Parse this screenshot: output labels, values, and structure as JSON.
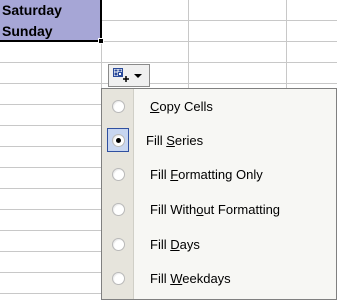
{
  "sheet": {
    "selected_cells": [
      "Saturday",
      "Sunday"
    ]
  },
  "autofill_button": {
    "icon": "autofill-options-icon",
    "dropdown_icon": "chevron-down-icon"
  },
  "menu": {
    "items": [
      {
        "before": "",
        "hotkey": "C",
        "after": "opy Cells",
        "selected": false
      },
      {
        "before": "Fill ",
        "hotkey": "S",
        "after": "eries",
        "selected": true
      },
      {
        "before": "Fill ",
        "hotkey": "F",
        "after": "ormatting Only",
        "selected": false
      },
      {
        "before": "Fill With",
        "hotkey": "o",
        "after": "ut Formatting",
        "selected": false
      },
      {
        "before": "Fill ",
        "hotkey": "D",
        "after": "ays",
        "selected": false
      },
      {
        "before": "Fill ",
        "hotkey": "W",
        "after": "eekdays",
        "selected": false
      }
    ]
  }
}
